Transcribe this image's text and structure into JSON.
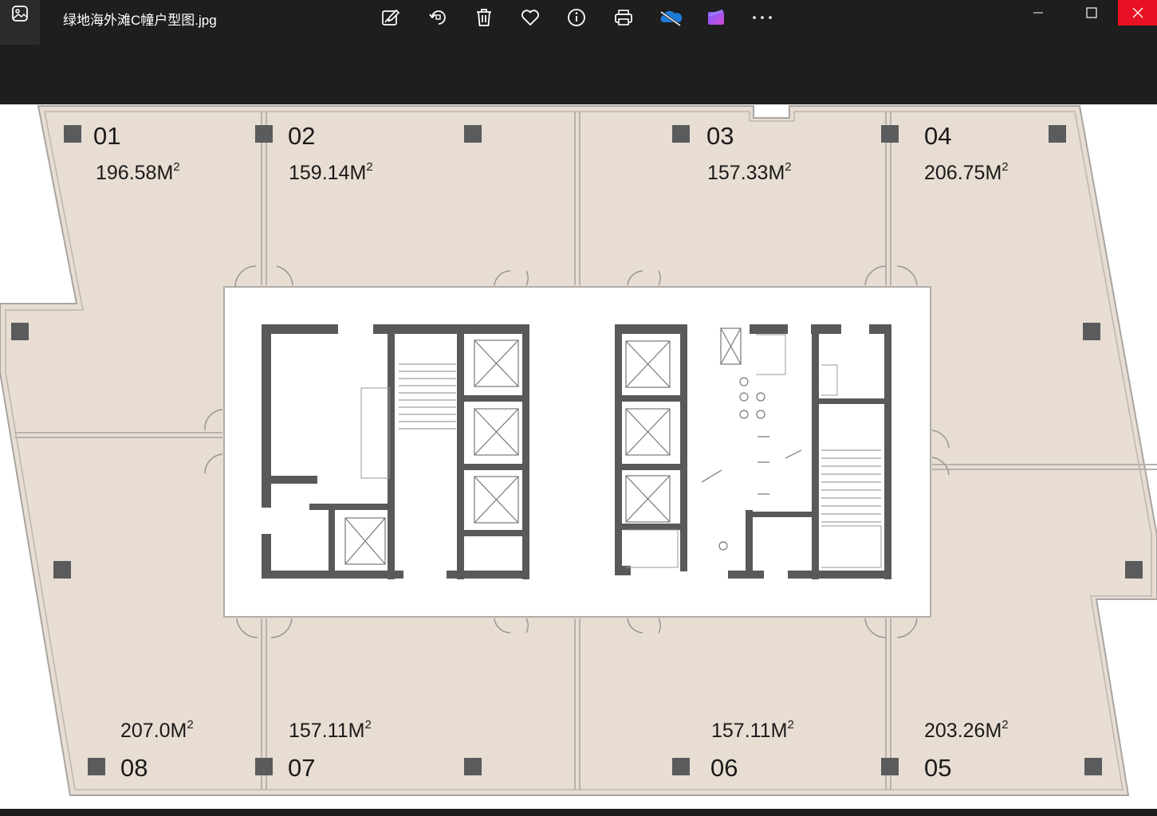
{
  "window": {
    "file_name": "绿地海外滩C幢户型图.jpg",
    "toolbar": [
      {
        "name": "edit-icon"
      },
      {
        "name": "rotate-icon"
      },
      {
        "name": "delete-icon"
      },
      {
        "name": "favorite-heart-icon"
      },
      {
        "name": "info-icon"
      },
      {
        "name": "print-icon"
      },
      {
        "name": "onedrive-cloud-icon"
      },
      {
        "name": "clipchamp-video-icon"
      },
      {
        "name": "more-options-icon"
      }
    ],
    "colors": {
      "titlebar": "#1e1e1e",
      "close_button": "#e81123",
      "floor_fill": "#e8ddd2",
      "wall": "#58595b"
    }
  },
  "floorplan": {
    "units": [
      {
        "number": "01",
        "area": "196.58M",
        "unit_sup": "2"
      },
      {
        "number": "02",
        "area": "159.14M",
        "unit_sup": "2"
      },
      {
        "number": "03",
        "area": "157.33M",
        "unit_sup": "2"
      },
      {
        "number": "04",
        "area": "206.75M",
        "unit_sup": "2"
      },
      {
        "number": "05",
        "area": "203.26M",
        "unit_sup": "2"
      },
      {
        "number": "06",
        "area": "157.11M",
        "unit_sup": "2"
      },
      {
        "number": "07",
        "area": "157.11M",
        "unit_sup": "2"
      },
      {
        "number": "08",
        "area": "207.0M",
        "unit_sup": "2"
      }
    ]
  }
}
